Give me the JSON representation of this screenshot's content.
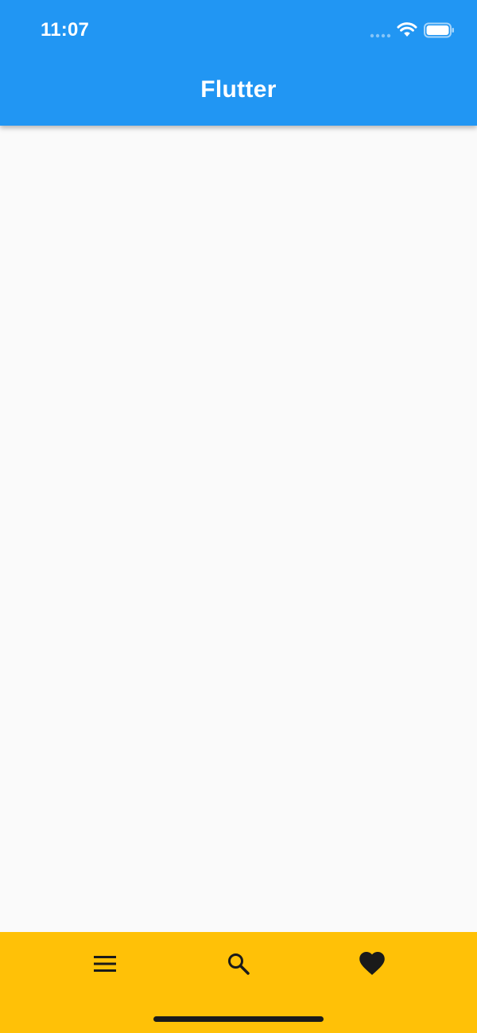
{
  "status_bar": {
    "time": "11:07",
    "icons": [
      "signal-icon",
      "wifi-icon",
      "battery-icon"
    ]
  },
  "app_bar": {
    "title": "Flutter",
    "color": "#2196F3"
  },
  "bottom_bar": {
    "color": "#FFC107",
    "items": [
      {
        "icon": "menu-icon"
      },
      {
        "icon": "search-icon"
      },
      {
        "icon": "heart-icon"
      }
    ]
  }
}
